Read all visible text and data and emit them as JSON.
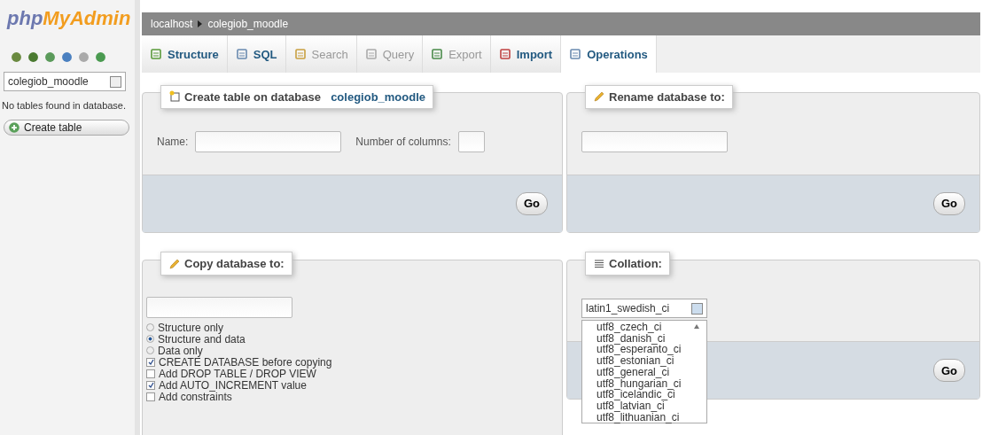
{
  "sidebar": {
    "logo": {
      "first": "php",
      "second": "MyAdmin"
    },
    "database_select": {
      "value": "colegiob_moodle"
    },
    "message": "No tables found in database.",
    "create_button": "Create table"
  },
  "breadcrumb": [
    {
      "label": "localhost"
    },
    {
      "label": "colegiob_moodle"
    }
  ],
  "tabs": [
    {
      "label": "Structure",
      "selected": false,
      "disabled": false
    },
    {
      "label": "SQL",
      "selected": false,
      "disabled": false
    },
    {
      "label": "Search",
      "selected": false,
      "disabled": true
    },
    {
      "label": "Query",
      "selected": false,
      "disabled": true
    },
    {
      "label": "Export",
      "selected": false,
      "disabled": true
    },
    {
      "label": "Import",
      "selected": false,
      "disabled": false
    },
    {
      "label": "Operations",
      "selected": true,
      "disabled": false
    }
  ],
  "create_table": {
    "legend": "Create table on database ",
    "database": "colegiob_moodle",
    "name_label": "Name:",
    "columns_label": "Number of columns:",
    "go": "Go"
  },
  "rename": {
    "legend": "Rename database to:",
    "go": "Go"
  },
  "copy": {
    "legend": "Copy database to:",
    "options": [
      {
        "kind": "radio",
        "label": "Structure only",
        "checked": false
      },
      {
        "kind": "radio",
        "label": "Structure and data",
        "checked": true
      },
      {
        "kind": "radio",
        "label": "Data only",
        "checked": false
      },
      {
        "kind": "checkbox",
        "label": "CREATE DATABASE before copying",
        "checked": true
      },
      {
        "kind": "checkbox",
        "label": "Add DROP TABLE / DROP VIEW",
        "checked": false
      },
      {
        "kind": "checkbox",
        "label": "Add AUTO_INCREMENT value",
        "checked": true
      },
      {
        "kind": "checkbox",
        "label": "Add constraints",
        "checked": false
      }
    ]
  },
  "collation": {
    "legend": "Collation:",
    "value": "latin1_swedish_ci",
    "go": "Go",
    "options": [
      "utf8_czech_ci",
      "utf8_danish_ci",
      "utf8_esperanto_ci",
      "utf8_estonian_ci",
      "utf8_general_ci",
      "utf8_hungarian_ci",
      "utf8_icelandic_ci",
      "utf8_latvian_ci",
      "utf8_lithuanian_ci"
    ]
  }
}
